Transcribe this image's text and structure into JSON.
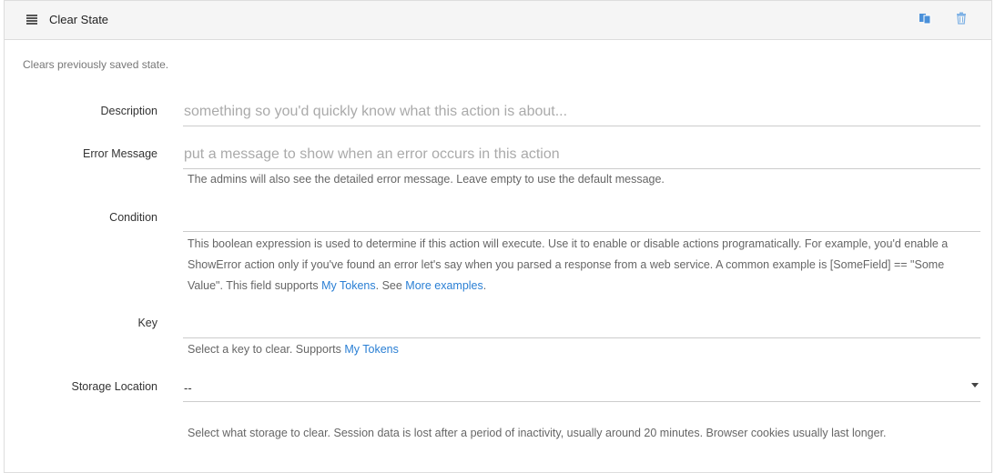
{
  "header": {
    "title": "Clear State",
    "drag_icon": "drag-handle-icon",
    "copy_icon": "copy-icon",
    "delete_icon": "trash-icon",
    "accent": "#4a90d9"
  },
  "intro": "Clears previously saved state.",
  "description": {
    "label": "Description",
    "placeholder": "something so you'd quickly know what this action is about...",
    "value": ""
  },
  "error_message": {
    "label": "Error Message",
    "placeholder": "put a message to show when an error occurs in this action",
    "value": "",
    "help": "The admins will also see the detailed error message. Leave empty to use the default message."
  },
  "condition": {
    "label": "Condition",
    "value": "",
    "help_1": "This boolean expression is used to determine if this action will execute. Use it to enable or disable actions programatically. For example, you'd enable a ShowError action only if you've found an error let's say when you parsed a response from a web service. A common example is [SomeField] == \"Some Value\". This field supports ",
    "link_tokens": "My Tokens",
    "help_2": ". See ",
    "link_examples": "More examples",
    "help_3": "."
  },
  "key": {
    "label": "Key",
    "value": "",
    "help": "Select a key to clear. Supports ",
    "link_tokens": "My Tokens"
  },
  "storage": {
    "label": "Storage Location",
    "selected": "--",
    "help": "Select what storage to clear. Session data is lost after a period of inactivity, usually around 20 minutes. Browser cookies usually last longer."
  }
}
